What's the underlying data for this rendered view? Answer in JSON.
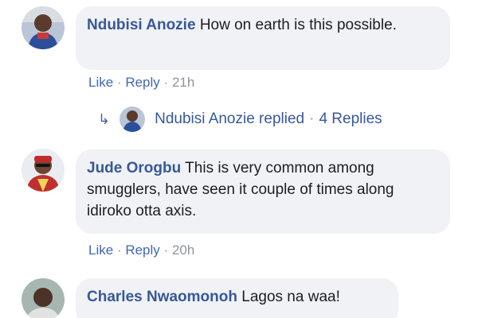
{
  "comments": [
    {
      "author": "Ndubisi Anozie",
      "text": "How on earth is this possible.",
      "actions": {
        "like": "Like",
        "reply": "Reply",
        "time": "21h"
      },
      "replies": {
        "author_replied": "Ndubisi Anozie replied",
        "count": "4 Replies"
      },
      "avatar_icon": "user-avatar-icon"
    },
    {
      "author": "Jude Orogbu",
      "text": "This is very common among smugglers, have seen it couple of times along idiroko otta axis.",
      "actions": {
        "like": "Like",
        "reply": "Reply",
        "time": "20h"
      },
      "avatar_icon": "user-avatar-icon"
    },
    {
      "author": "Charles Nwaomonoh",
      "text": "Lagos na waa!",
      "avatar_icon": "user-avatar-icon"
    }
  ],
  "separator": "·",
  "colors": {
    "author": "#385898",
    "link": "#4267b2",
    "muted": "#90949c",
    "bubble": "#f0f2f5"
  }
}
